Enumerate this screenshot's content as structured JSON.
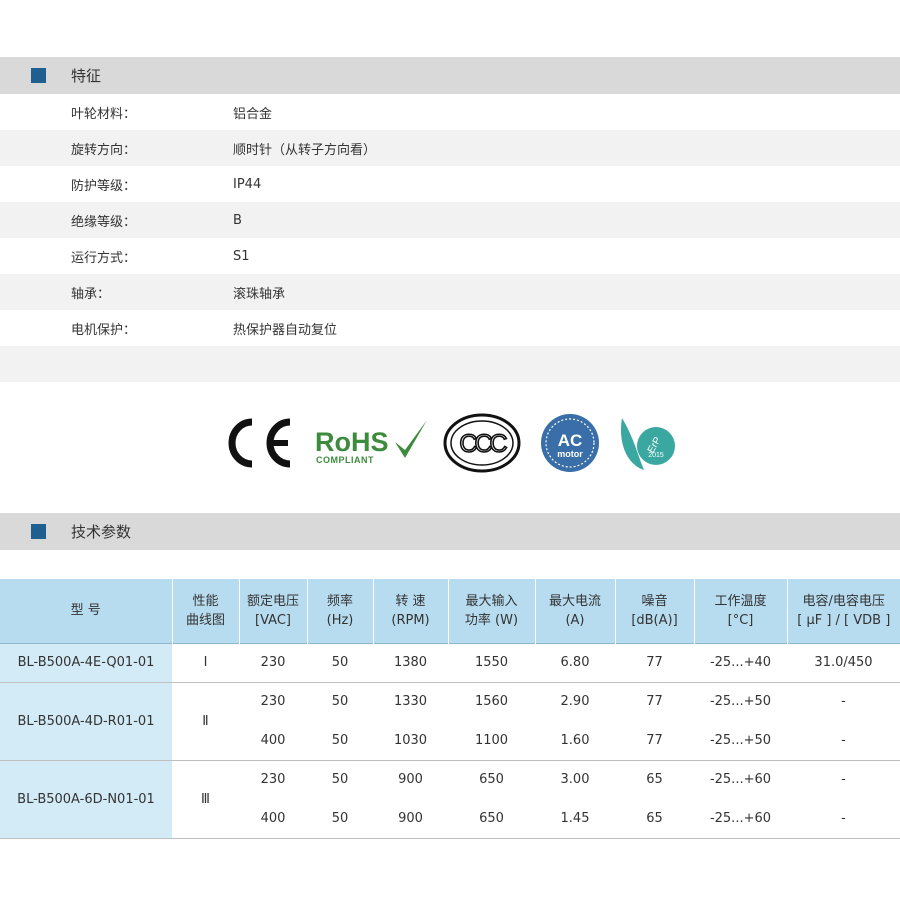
{
  "features": {
    "title": "特征",
    "rows": [
      {
        "label": "叶轮材料：",
        "value": "铝合金"
      },
      {
        "label": "旋转方向：",
        "value": "顺时针（从转子方向看）"
      },
      {
        "label": "防护等级：",
        "value": "IP44"
      },
      {
        "label": "绝缘等级：",
        "value": "B"
      },
      {
        "label": "运行方式：",
        "value": "S1"
      },
      {
        "label": "轴承：",
        "value": "滚珠轴承"
      },
      {
        "label": "电机保护：",
        "value": "热保护器自动复位"
      },
      {
        "label": "",
        "value": ""
      }
    ]
  },
  "logos": {
    "ce": "CE",
    "rohs": "RoHS",
    "rohs_sub": "COMPLIANT",
    "ccc": "CCC",
    "ac_top": "AC",
    "ac_bottom": "motor",
    "erp_top": "ErP",
    "erp_bottom": "2015"
  },
  "specs": {
    "title": "技术参数",
    "headers": [
      {
        "line1": "型 号",
        "line2": ""
      },
      {
        "line1": "性能",
        "line2": "曲线图"
      },
      {
        "line1": "额定电压",
        "line2": "[VAC]"
      },
      {
        "line1": "频率",
        "line2": "(Hz)"
      },
      {
        "line1": "转 速",
        "line2": "(RPM)"
      },
      {
        "line1": "最大输入",
        "line2": "功率 (W)"
      },
      {
        "line1": "最大电流",
        "line2": "(A)"
      },
      {
        "line1": "噪音",
        "line2": "[dB(A)]"
      },
      {
        "line1": "工作温度",
        "line2": "[°C]"
      },
      {
        "line1": "电容/电容电压",
        "line2": "[ μF ] / [ VDB ]"
      }
    ],
    "groups": [
      {
        "model": "BL-B500A-4E-Q01-01",
        "curve": "Ⅰ",
        "rows": [
          {
            "voltage": "230",
            "freq": "50",
            "rpm": "1380",
            "power": "1550",
            "current": "6.80",
            "noise": "77",
            "temp": "-25...+40",
            "cap": "31.0/450"
          }
        ]
      },
      {
        "model": "BL-B500A-4D-R01-01",
        "curve": "Ⅱ",
        "rows": [
          {
            "voltage": "230",
            "freq": "50",
            "rpm": "1330",
            "power": "1560",
            "current": "2.90",
            "noise": "77",
            "temp": "-25...+50",
            "cap": "-"
          },
          {
            "voltage": "400",
            "freq": "50",
            "rpm": "1030",
            "power": "1100",
            "current": "1.60",
            "noise": "77",
            "temp": "-25...+50",
            "cap": "-"
          }
        ]
      },
      {
        "model": "BL-B500A-6D-N01-01",
        "curve": "Ⅲ",
        "rows": [
          {
            "voltage": "230",
            "freq": "50",
            "rpm": "900",
            "power": "650",
            "current": "3.00",
            "noise": "65",
            "temp": "-25...+60",
            "cap": "-"
          },
          {
            "voltage": "400",
            "freq": "50",
            "rpm": "900",
            "power": "650",
            "current": "1.45",
            "noise": "65",
            "temp": "-25...+60",
            "cap": "-"
          }
        ]
      }
    ]
  },
  "colors": {
    "marker": "#1f5f8f",
    "header_band": "#d9d9da",
    "table_header": "#b7dcef",
    "model_cell": "#d3ebf6",
    "rohs_green": "#3d8b3d",
    "ac_blue": "#3a6ea8",
    "erp_teal": "#3aa7a0"
  }
}
